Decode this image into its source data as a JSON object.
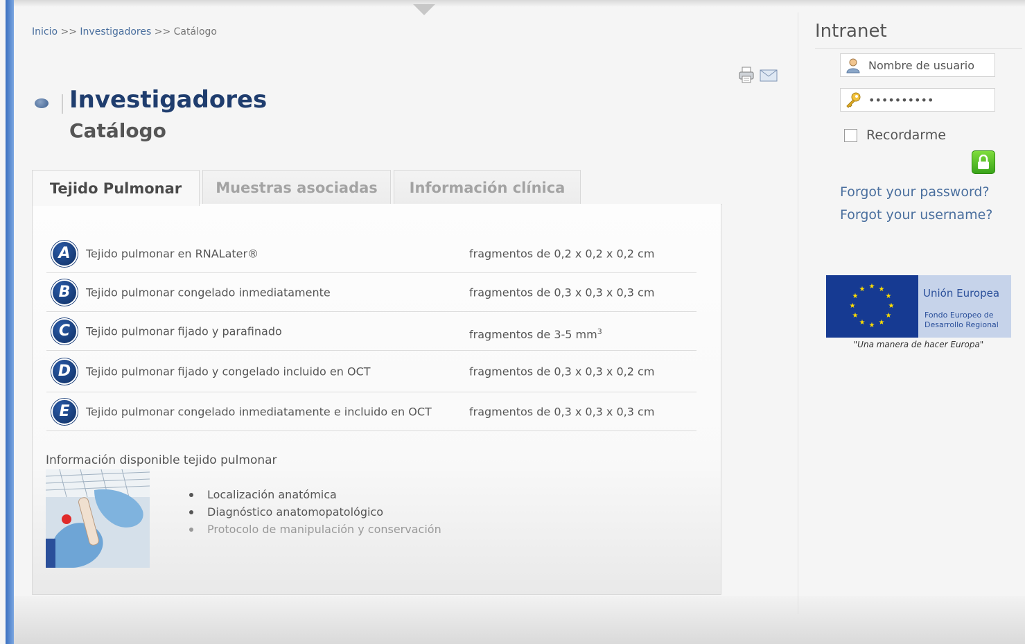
{
  "breadcrumb": {
    "home": "Inicio",
    "sep1": ">>",
    "section": "Investigadores",
    "sep2": ">>",
    "current": "Catálogo"
  },
  "page": {
    "title": "Investigadores",
    "subtitle": "Catálogo"
  },
  "tabs": [
    {
      "label": "Tejido Pulmonar",
      "active": true
    },
    {
      "label": "Muestras asociadas",
      "active": false
    },
    {
      "label": "Información clínica",
      "active": false
    }
  ],
  "rows": [
    {
      "letter": "A",
      "description": "Tejido pulmonar en RNALater®",
      "size": "fragmentos de 0,2 x 0,2 x 0,2 cm"
    },
    {
      "letter": "B",
      "description": "Tejido pulmonar congelado inmediatamente",
      "size": "fragmentos de 0,3 x 0,3 x 0,3 cm"
    },
    {
      "letter": "C",
      "description": "Tejido pulmonar fijado y parafinado",
      "size": "fragmentos de 3-5 mm",
      "size_sup": "3"
    },
    {
      "letter": "D",
      "description": "Tejido pulmonar fijado y congelado incluido en OCT",
      "size": "fragmentos de 0,3 x 0,3 x 0,2 cm"
    },
    {
      "letter": "E",
      "description": "Tejido pulmonar congelado inmediatamente e incluido en OCT",
      "size": "fragmentos de 0,3 x 0,3 x 0,3 cm"
    }
  ],
  "info": {
    "title": "Información disponible tejido pulmonar",
    "items": [
      "Localización anatómica",
      "Diagnóstico anatomopatológico",
      "Protocolo de manipulación y conservación"
    ]
  },
  "sidebar": {
    "title": "Intranet",
    "username_placeholder": "Nombre de usuario",
    "password_value": "••••••••••",
    "remember_label": "Recordarme",
    "forgot_password": "Forgot your password?",
    "forgot_username": "Forgot your username?"
  },
  "eu": {
    "name": "Unión Europea",
    "fund_line1": "Fondo Europeo de",
    "fund_line2": "Desarrollo Regional",
    "motto": "\"Una manera de hacer Europa\""
  },
  "icons": [
    "print-icon",
    "mail-icon",
    "user-icon",
    "key-icon",
    "lock-icon"
  ],
  "colors": {
    "brand_blue": "#1f3d6e",
    "link_blue": "#4a6f9e",
    "login_green": "#39a41a"
  }
}
